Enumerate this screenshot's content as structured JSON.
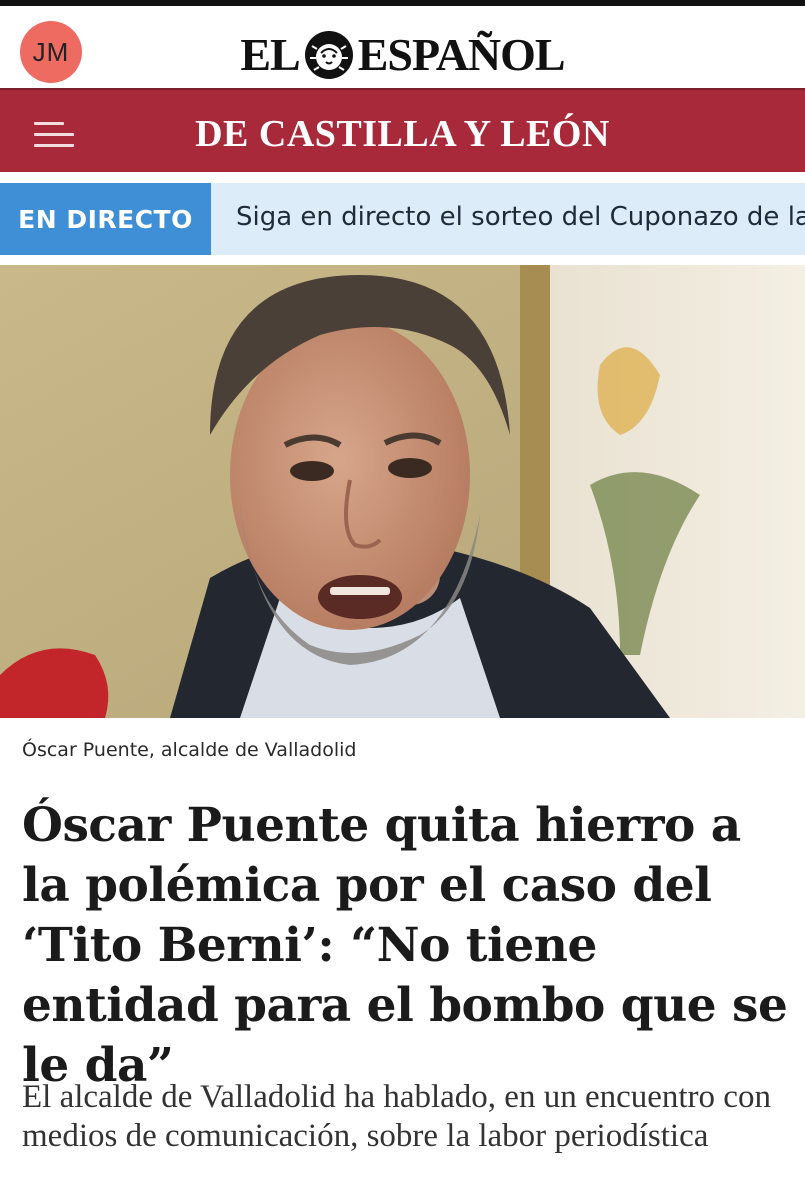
{
  "header": {
    "avatar_initials": "JM",
    "logo_left": "EL",
    "logo_right": "ESPAÑOL",
    "logo_icon": "lion-icon",
    "colors": {
      "avatar_bg": "#ee6b62"
    }
  },
  "section": {
    "menu_icon": "hamburger-menu-icon",
    "title": "DE CASTILLA Y LEÓN",
    "colors": {
      "background": "#a8293a"
    }
  },
  "live": {
    "badge": "EN DIRECTO",
    "headline": "Siga en directo el sorteo del Cuponazo de la ONCE",
    "colors": {
      "badge_bg": "#3f8fd6",
      "bar_bg": "#dcecf9"
    }
  },
  "article": {
    "photo_caption": "Óscar Puente, alcalde de Valladolid",
    "headline": "Óscar Puente quita hierro a la polémica por el caso del ‘Tito Berni’: “No tiene entidad para el bombo que se le da”",
    "subheadline": "El alcalde de Valladolid ha hablado, en un encuentro con medios de comunicación, sobre la labor periodística"
  }
}
